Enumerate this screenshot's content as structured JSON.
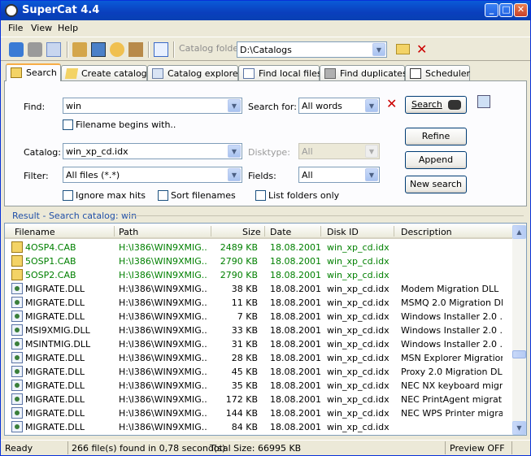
{
  "window": {
    "title": "SuperCat 4.4"
  },
  "menu": [
    "File",
    "View",
    "Help"
  ],
  "toolbar": {
    "catalog_folder_label": "Catalog folder",
    "catalog_folder_value": "D:\\Catalogs"
  },
  "tabs": [
    {
      "label": "Search",
      "icon": "search-tab-icon"
    },
    {
      "label": "Create catalog",
      "icon": "create-catalog-icon"
    },
    {
      "label": "Catalog explorer",
      "icon": "catalog-explorer-icon"
    },
    {
      "label": "Find local files",
      "icon": "find-local-files-icon"
    },
    {
      "label": "Find duplicates",
      "icon": "find-duplicates-icon"
    },
    {
      "label": "Scheduler",
      "icon": "scheduler-icon"
    }
  ],
  "search": {
    "find_label": "Find:",
    "find_value": "win",
    "search_for_label": "Search for:",
    "search_for_value": "All words",
    "filename_begins_label": "Filename begins with..",
    "catalog_label": "Catalog:",
    "catalog_value": "win_xp_cd.idx",
    "disktype_label": "Disktype:",
    "disktype_value": "All",
    "filter_label": "Filter:",
    "filter_value": "All files (*.*)",
    "fields_label": "Fields:",
    "fields_value": "All",
    "ignore_max_hits_label": "Ignore max hits",
    "sort_filenames_label": "Sort filenames",
    "list_folders_label": "List folders only",
    "search_button": "Search",
    "refine_button": "Refine",
    "append_button": "Append",
    "new_search_button": "New search"
  },
  "result": {
    "title": "Result - Search catalog: win",
    "columns": [
      "Filename",
      "Path",
      "Size",
      "Date",
      "Disk ID",
      "Description"
    ],
    "rows": [
      {
        "type": "cab",
        "name": "4OSP4.CAB",
        "path": "H:\\I386\\WIN9XMIG...",
        "size": "2489 KB",
        "date": "18.08.2001",
        "disk": "win_xp_cd.idx",
        "desc": ""
      },
      {
        "type": "cab",
        "name": "5OSP1.CAB",
        "path": "H:\\I386\\WIN9XMIG...",
        "size": "2790 KB",
        "date": "18.08.2001",
        "disk": "win_xp_cd.idx",
        "desc": ""
      },
      {
        "type": "cab",
        "name": "5OSP2.CAB",
        "path": "H:\\I386\\WIN9XMIG...",
        "size": "2790 KB",
        "date": "18.08.2001",
        "disk": "win_xp_cd.idx",
        "desc": ""
      },
      {
        "type": "dll",
        "name": "MIGRATE.DLL",
        "path": "H:\\I386\\WIN9XMIG...",
        "size": "38 KB",
        "date": "18.08.2001",
        "disk": "win_xp_cd.idx",
        "desc": "Modem Migration DLL"
      },
      {
        "type": "dll",
        "name": "MIGRATE.DLL",
        "path": "H:\\I386\\WIN9XMIG...",
        "size": "11 KB",
        "date": "18.08.2001",
        "disk": "win_xp_cd.idx",
        "desc": "MSMQ 2.0 Migration DL..."
      },
      {
        "type": "dll",
        "name": "MIGRATE.DLL",
        "path": "H:\\I386\\WIN9XMIG...",
        "size": "7 KB",
        "date": "18.08.2001",
        "disk": "win_xp_cd.idx",
        "desc": "Windows Installer 2.0 ..."
      },
      {
        "type": "dll",
        "name": "MSI9XMIG.DLL",
        "path": "H:\\I386\\WIN9XMIG...",
        "size": "33 KB",
        "date": "18.08.2001",
        "disk": "win_xp_cd.idx",
        "desc": "Windows Installer 2.0 ..."
      },
      {
        "type": "dll",
        "name": "MSINTMIG.DLL",
        "path": "H:\\I386\\WIN9XMIG...",
        "size": "31 KB",
        "date": "18.08.2001",
        "disk": "win_xp_cd.idx",
        "desc": "Windows Installer 2.0 ..."
      },
      {
        "type": "dll",
        "name": "MIGRATE.DLL",
        "path": "H:\\I386\\WIN9XMIG...",
        "size": "28 KB",
        "date": "18.08.2001",
        "disk": "win_xp_cd.idx",
        "desc": "MSN Explorer Migration..."
      },
      {
        "type": "dll",
        "name": "MIGRATE.DLL",
        "path": "H:\\I386\\WIN9XMIG...",
        "size": "45 KB",
        "date": "18.08.2001",
        "disk": "win_xp_cd.idx",
        "desc": "Proxy 2.0 Migration DL..."
      },
      {
        "type": "dll",
        "name": "MIGRATE.DLL",
        "path": "H:\\I386\\WIN9XMIG...",
        "size": "35 KB",
        "date": "18.08.2001",
        "disk": "win_xp_cd.idx",
        "desc": "NEC NX keyboard migr..."
      },
      {
        "type": "dll",
        "name": "MIGRATE.DLL",
        "path": "H:\\I386\\WIN9XMIG...",
        "size": "172 KB",
        "date": "18.08.2001",
        "disk": "win_xp_cd.idx",
        "desc": "NEC PrintAgent migrati..."
      },
      {
        "type": "dll",
        "name": "MIGRATE.DLL",
        "path": "H:\\I386\\WIN9XMIG...",
        "size": "144 KB",
        "date": "18.08.2001",
        "disk": "win_xp_cd.idx",
        "desc": "NEC WPS Printer migra..."
      },
      {
        "type": "dll",
        "name": "MIGRATE.DLL",
        "path": "H:\\I386\\WIN9XMIG...",
        "size": "84 KB",
        "date": "18.08.2001",
        "disk": "win_xp_cd.idx",
        "desc": ""
      }
    ]
  },
  "status": {
    "state": "Ready",
    "summary": "266 file(s) found in 0,78 second(s)",
    "total_size": "Total Size: 66995 KB",
    "preview": "Preview OFF"
  },
  "colors": {
    "green_row": "#008000",
    "titlebar": "#0a4fc8",
    "accent_tab": "#f7ad47"
  }
}
